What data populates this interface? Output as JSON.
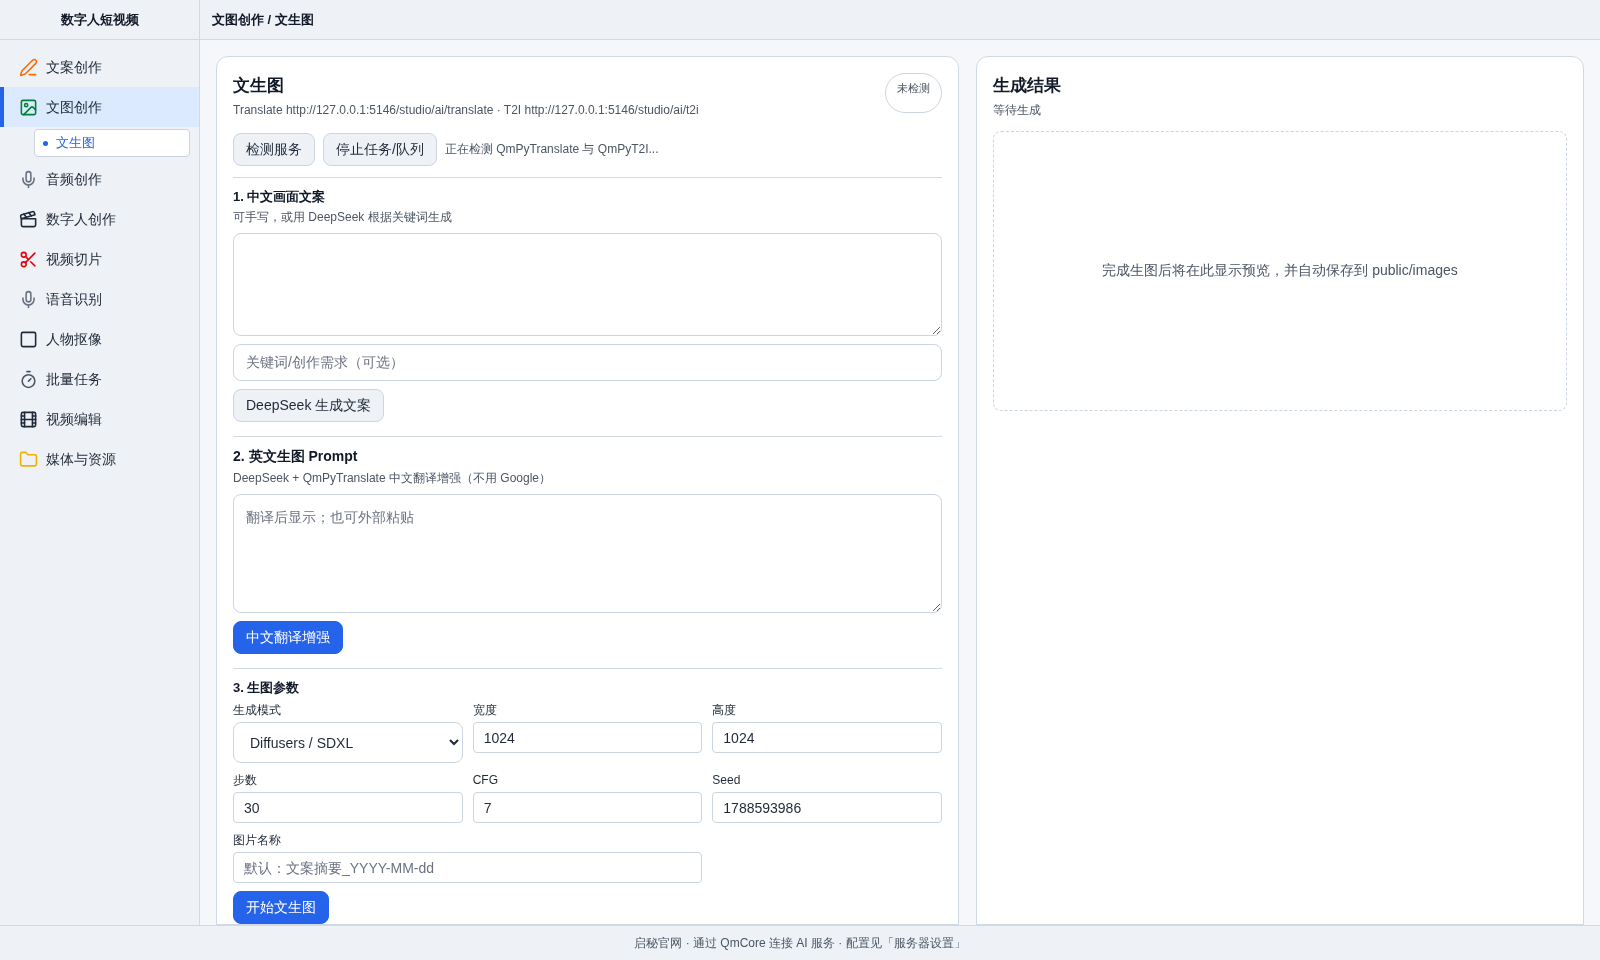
{
  "app": {
    "title": "数字人短视频"
  },
  "breadcrumb": "文图创作 / 文生图",
  "sidebar": {
    "items": [
      {
        "label": "文案创作",
        "selected": false
      },
      {
        "label": "文图创作",
        "selected": true,
        "children": [
          {
            "label": "文生图",
            "selected": true
          }
        ]
      },
      {
        "label": "音频创作",
        "selected": false
      },
      {
        "label": "数字人创作",
        "selected": false
      },
      {
        "label": "视频切片",
        "selected": false
      },
      {
        "label": "语音识别",
        "selected": false
      },
      {
        "label": "人物抠像",
        "selected": false
      },
      {
        "label": "批量任务",
        "selected": false
      },
      {
        "label": "视频编辑",
        "selected": false
      },
      {
        "label": "媒体与资源",
        "selected": false
      }
    ]
  },
  "panel": {
    "title": "文生图",
    "endpoints": "Translate http://127.0.0.1:5146/studio/ai/translate · T2I http://127.0.0.1:5146/studio/ai/t2i",
    "status_badge": "未检测",
    "buttons": [
      {
        "label": "检测服务",
        "kind": "secondary"
      },
      {
        "label": "停止任务/队列",
        "kind": "secondary"
      }
    ],
    "status_text": "正在检测 QmPyTranslate 与 QmPyT2I...",
    "section_1": {
      "title": "1. 中文画面文案",
      "hint": "可手写，或用 DeepSeek 根据关键词生成",
      "keyword_field": {
        "placeholder": "关键词/创作需求（可选）"
      },
      "button": {
        "label": "DeepSeek 生成文案",
        "kind": "secondary"
      }
    },
    "section_2": {
      "title": "2. 英文生图 Prompt",
      "hint": "DeepSeek + QmPyTranslate 中文翻译增强（不用 Google）",
      "prompt_field": {
        "placeholder": "翻译后显示；也可外部粘贴"
      },
      "button": {
        "label": "中文翻译增强",
        "kind": "primary"
      }
    },
    "section_3": {
      "title": "3. 生图参数",
      "fields": [
        {
          "label": "生成模式",
          "kind": "select",
          "value": "Diffusers / SDXL"
        },
        {
          "label": "宽度",
          "kind": "input",
          "value": "1024"
        },
        {
          "label": "高度",
          "kind": "input",
          "value": "1024"
        },
        {
          "label": "步数",
          "kind": "input",
          "value": "30"
        },
        {
          "label": "CFG",
          "kind": "input",
          "value": "7"
        },
        {
          "label": "Seed",
          "kind": "input",
          "value": "1788593986"
        }
      ],
      "name_field": {
        "label": "图片名称",
        "placeholder": "默认：文案摘要_YYYY-MM-dd"
      },
      "button": {
        "label": "开始文生图",
        "kind": "primary"
      }
    }
  },
  "result": {
    "title": "生成结果",
    "subtitle": "等待生成",
    "placeholder_text": "完成生图后将在此显示预览，并自动保存到 public/images"
  },
  "footer": {
    "link": "启秘官网",
    "text": " · 通过 QmCore 连接 AI 服务 · 配置见「服务器设置」"
  }
}
